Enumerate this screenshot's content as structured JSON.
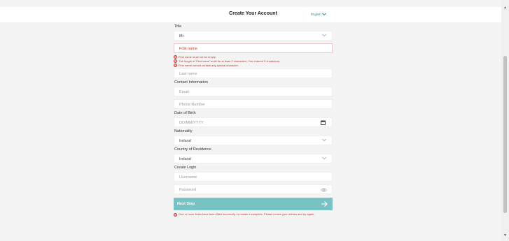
{
  "header": {
    "title": "Create Your Account",
    "language": "English"
  },
  "title_field": {
    "label": "Title",
    "value": "Mr"
  },
  "first_name": {
    "placeholder": "First name",
    "errors": [
      "First name must not be empty.",
      "The length of 'First name' must be at least 2 characters. You entered 0 characters.",
      "First name cannot contain any special character."
    ]
  },
  "last_name": {
    "placeholder": "Last name"
  },
  "contact": {
    "label": "Contact Information",
    "email_placeholder": "Email",
    "phone_placeholder": "Phone Number"
  },
  "dob": {
    "label": "Date of Birth",
    "placeholder": "DD/MM/YYYY"
  },
  "nationality": {
    "label": "Nationality",
    "value": "Ireland"
  },
  "residence": {
    "label": "Country of Residence",
    "value": "Ireland"
  },
  "login": {
    "label": "Create Login",
    "username_placeholder": "Username",
    "password_placeholder": "Password"
  },
  "next_button": {
    "label": "Next Step"
  },
  "form_error": "One or more fields have been filled incorrectly or remain incomplete. Please review your entries and try again.",
  "colors": {
    "accent": "#79c2c4",
    "error": "#c0392b",
    "link": "#1e8f8f"
  }
}
